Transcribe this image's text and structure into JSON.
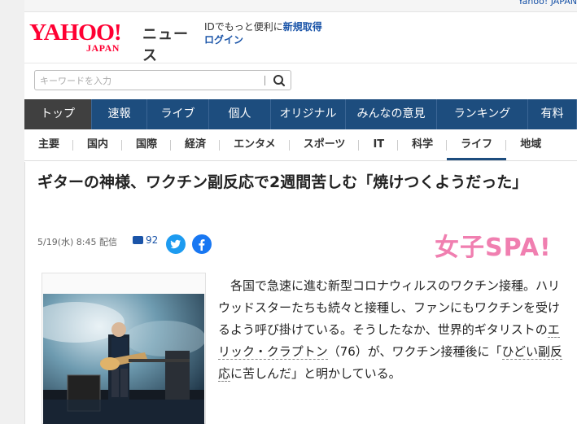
{
  "topbar": {
    "link": "Yahoo! JAPAN"
  },
  "logo": {
    "yahoo": "YAHOO!",
    "japan": "JAPAN",
    "news": "ニュース"
  },
  "promo": {
    "text": "IDでもっと便利に",
    "signup": "新規取得",
    "login": "ログイン"
  },
  "search": {
    "placeholder": "キーワードを入力"
  },
  "main_nav": [
    "トップ",
    "速報",
    "ライブ",
    "個人",
    "オリジナル",
    "みんなの意見",
    "ランキング",
    "有料"
  ],
  "sub_nav": [
    "主要",
    "国内",
    "国際",
    "経済",
    "エンタメ",
    "スポーツ",
    "IT",
    "科学",
    "ライフ",
    "地域"
  ],
  "article": {
    "headline": "ギターの神様、ワクチン副反応で2週間苦しむ「焼けつくようだった」",
    "date": "5/19(水) 8:45 配信",
    "comment_count": "92",
    "source": "女子SPA!",
    "body_1": "　各国で急速に進む新型コロナウィルスのワクチン接種。ハリウッドスターたちも続々と接種し、ファンにもワクチンを受けるよう呼び掛けている。そうしたなか、世界的ギタリストの",
    "body_link_1": "エリック・クラプトン",
    "body_2": "（76）が、ワクチン接種後に「",
    "body_link_2": "ひどい副反応",
    "body_3": "に苦しんだ」と明かしている。"
  },
  "colors": {
    "nav": "#1d4d7e",
    "nav_active": "#404040",
    "brand_red": "#ff0033",
    "link": "#1a54a8",
    "source_pink": "#f07fb0"
  },
  "icons": [
    "search-icon",
    "comment-icon",
    "twitter-icon",
    "facebook-icon"
  ]
}
